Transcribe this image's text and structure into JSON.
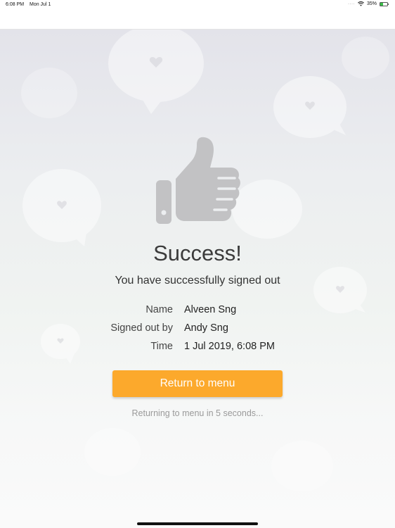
{
  "status_bar": {
    "time": "6:08 PM",
    "date": "Mon Jul 1",
    "battery": "35%",
    "battery_level": 0.35,
    "icons": [
      "signal-dots-icon",
      "wifi-icon",
      "battery-icon"
    ]
  },
  "success": {
    "icon": "thumbs-up-icon",
    "title": "Success!",
    "message": "You have successfully signed out"
  },
  "details": [
    {
      "label": "Name",
      "value": "Alveen Sng"
    },
    {
      "label": "Signed out by",
      "value": "Andy Sng"
    },
    {
      "label": "Time",
      "value": "1 Jul 2019, 6:08 PM"
    }
  ],
  "actions": {
    "return_label": "Return to menu",
    "countdown_text": "Returning to menu in 5 seconds..."
  },
  "colors": {
    "accent": "#fca92c",
    "icon_gray": "#c2c2c4"
  }
}
